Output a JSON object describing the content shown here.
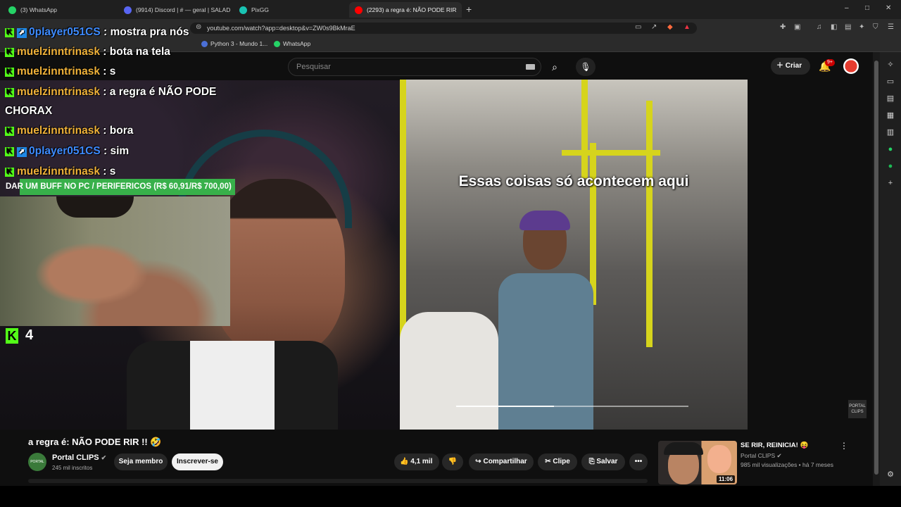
{
  "browser": {
    "tabs": [
      {
        "title": "(3) WhatsApp",
        "favicon": "whatsapp-icon",
        "color": "#25d366"
      },
      {
        "title": "(9914) Discord | # — geral | SALAD",
        "favicon": "discord-icon",
        "color": "#5865f2"
      },
      {
        "title": "PixGG",
        "favicon": "pixgg-icon",
        "color": "#19c3b3"
      },
      {
        "title": "(2293) a regra é: NÃO PODE RIR",
        "favicon": "youtube-icon",
        "color": "#ff0000"
      }
    ],
    "new_tab": "+",
    "url": "youtube.com/watch?app=desktop&v=ZW0s9BkMraE",
    "bookmarks": [
      {
        "label": "Python 3 - Mundo 1...",
        "icon": "python-icon",
        "color": "#4b6fd6"
      },
      {
        "label": "WhatsApp",
        "icon": "whatsapp-icon",
        "color": "#25d366"
      }
    ],
    "window_controls": [
      "–",
      "□",
      "✕"
    ]
  },
  "youtube": {
    "search_placeholder": "Pesquisar",
    "create_label": "Criar",
    "notif_badge": "9+"
  },
  "chat": {
    "messages": [
      {
        "badge": "kick",
        "sub": true,
        "user": "0player051CS",
        "color": "blue",
        "text": ": mostra pra nós"
      },
      {
        "badge": "kick",
        "sub": false,
        "user": "muelzinntrinask",
        "color": "orange",
        "text": ": bota na tela"
      },
      {
        "badge": "kick",
        "sub": false,
        "user": "muelzinntrinask",
        "color": "orange",
        "text": ": s"
      },
      {
        "badge": "kick",
        "sub": false,
        "user": "muelzinntrinask",
        "color": "orange",
        "text": ": a regra é NÃO PODE"
      },
      {
        "badge": "",
        "sub": false,
        "user": "",
        "color": "",
        "text": "CHORAX"
      },
      {
        "badge": "kick",
        "sub": false,
        "user": "muelzinntrinask",
        "color": "orange",
        "text": ": bora"
      },
      {
        "badge": "kick",
        "sub": true,
        "user": "0player051CS",
        "color": "blue",
        "text": ": sim"
      },
      {
        "badge": "kick",
        "sub": false,
        "user": "muelzinntrinask",
        "color": "orange",
        "text": ": s"
      }
    ],
    "goal_text": "DAR UM BUFF NO PC / PERIFERICOS (R$ 60,91/R$ 700,00)",
    "goal_progress": 0.087,
    "viewer_count": "4"
  },
  "video": {
    "caption": "Essas coisas só acontecem aqui",
    "progress": 0.42,
    "watermark": "PORTAL CLIPS",
    "title": "a regra é: NÃO PODE RIR !! 🤣",
    "channel": "Portal CLIPS",
    "subscribers": "245 mil inscritos",
    "member_label": "Seja membro",
    "subscribe_label": "Inscrever-se",
    "likes": "4,1 mil",
    "share_label": "Compartilhar",
    "clip_label": "Clipe",
    "save_label": "Salvar"
  },
  "recommended": {
    "title": "SE RIR, REINICIA! 😝",
    "channel": "Portal CLIPS",
    "meta": "985 mil visualizações • há 7 meses",
    "duration": "11:06"
  }
}
